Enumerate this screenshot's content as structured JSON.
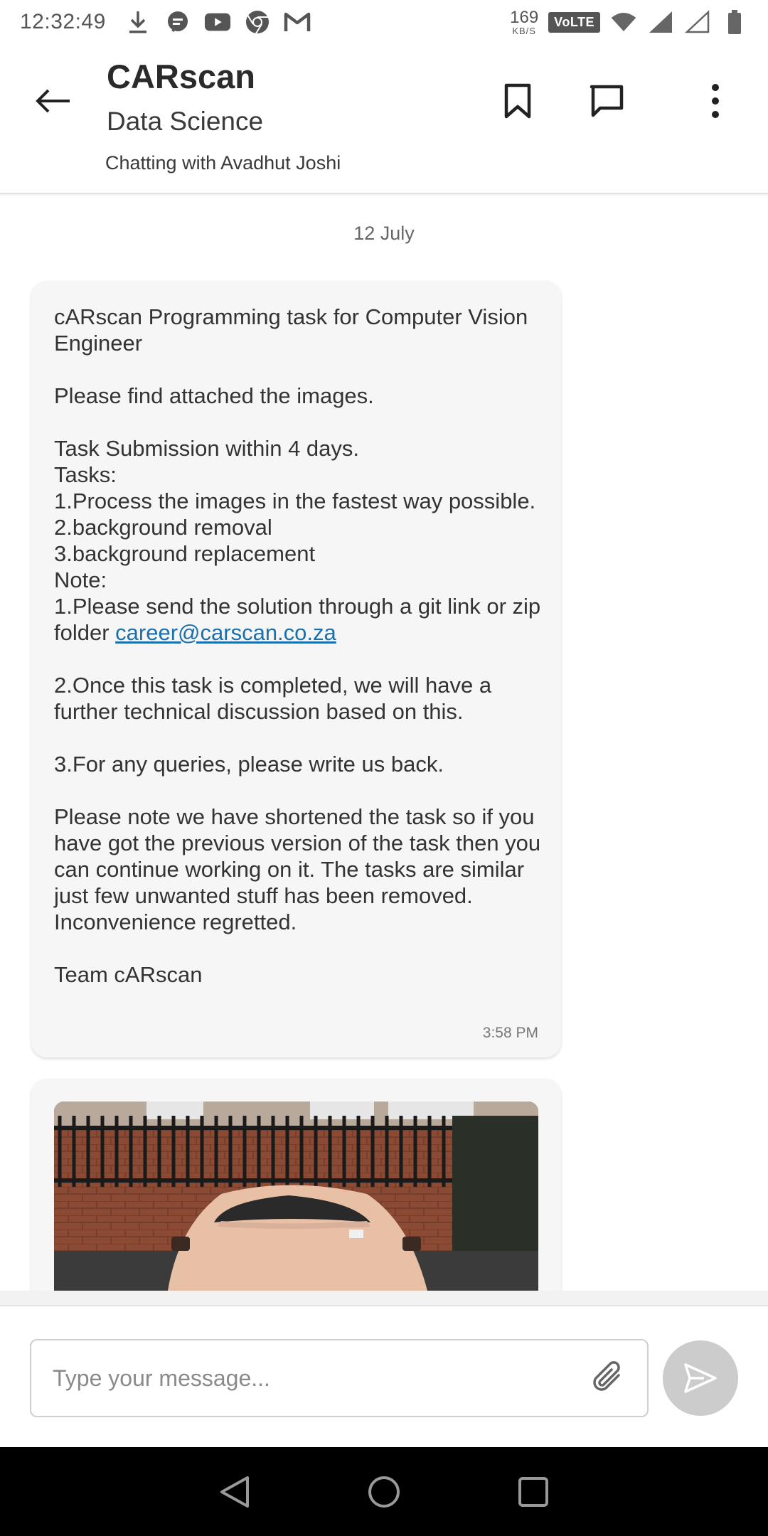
{
  "status_bar": {
    "time": "12:32:49",
    "net_speed": "169",
    "net_unit": "KB/S",
    "volte": "VoLTE"
  },
  "header": {
    "title": "CARscan",
    "subtitle": "Data Science",
    "chatting_with": "Chatting with Avadhut Joshi"
  },
  "chat": {
    "date_separator": "12 July",
    "message": {
      "line1": "cARscan Programming task for Computer Vision Engineer",
      "line2": "Please find attached the images.",
      "line3": "Task Submission within 4 days.",
      "line4": "Tasks:",
      "line5": "1.Process the images in the fastest way possible.",
      "line6": "2.background removal",
      "line7": "3.background replacement",
      "line8": "Note:",
      "line9_prefix": "1.Please send the solution through a git link or zip folder",
      "link": "career@carscan.co.za",
      "line10": "2.Once this task is completed, we will have a further technical discussion based on this.",
      "line11": "3.For any queries, please write us back.",
      "line12": "Please note we have shortened the task so if you have got the previous version of the task then you can continue working on it. The tasks are similar just few unwanted stuff has been removed. Inconvenience regretted.",
      "line13": "Team cARscan",
      "time": "3:58 PM"
    }
  },
  "input": {
    "placeholder": "Type your message..."
  },
  "colors": {
    "link": "#1a6fae",
    "send_button": "#cccccc",
    "bubble": "#f6f6f6"
  }
}
